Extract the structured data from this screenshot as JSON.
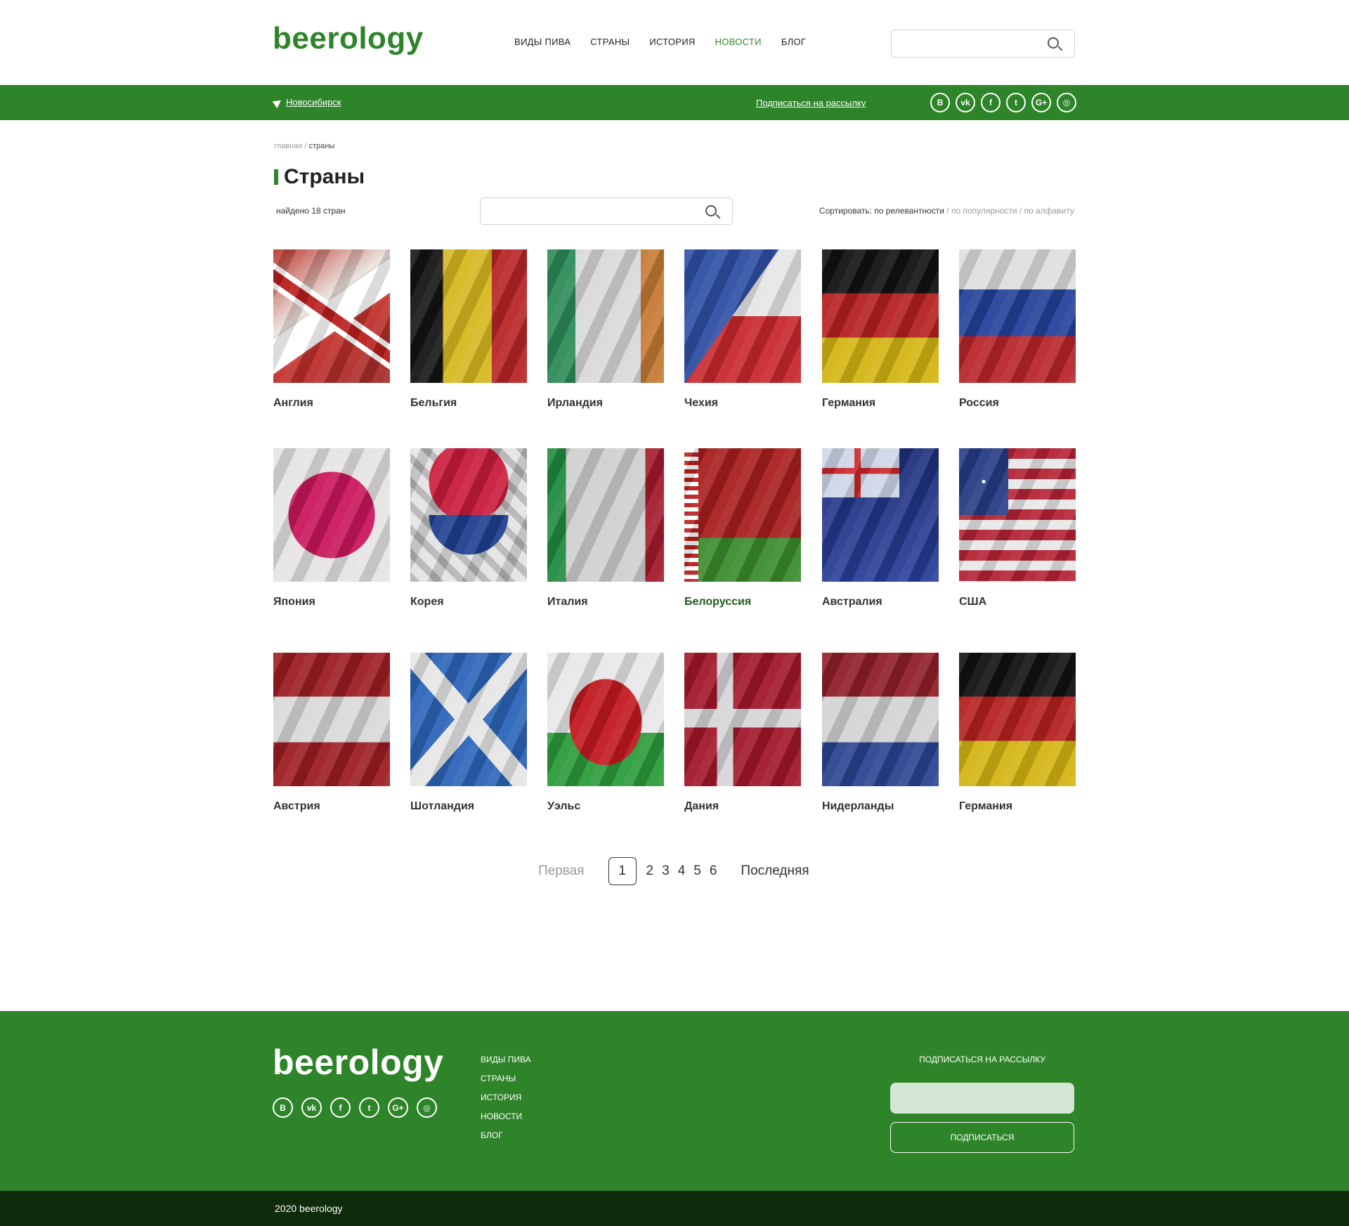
{
  "header": {
    "logo": "beerology",
    "nav": [
      "Виды пива",
      "Страны",
      "История",
      "Новости",
      "Блог"
    ],
    "active_nav_index": 3,
    "search_placeholder": ""
  },
  "topbar": {
    "city": "Новосибирск",
    "subscribe": "Подписаться на рассылку",
    "socials": [
      "vkontakte-b-icon",
      "vk-icon",
      "facebook-icon",
      "twitter-icon",
      "google-plus-icon",
      "instagram-icon"
    ],
    "social_glyphs": [
      "B",
      "vk",
      "f",
      "t",
      "G+",
      "◎"
    ]
  },
  "breadcrumb": {
    "home": "главная",
    "sep": " / ",
    "current": "страны"
  },
  "page": {
    "title": "Страны",
    "found": "найдено 18 стран",
    "sort_label": "Сортировать: по релевантности",
    "sort_sep": " / ",
    "sort_popular": "по популярности",
    "sort_alpha": "по алфавиту"
  },
  "countries": [
    "Англия",
    "Бельгия",
    "Ирландия",
    "Чехия",
    "Германия",
    "Россия",
    "Япония",
    "Корея",
    "Италия",
    "Белоруссия",
    "Австралия",
    "США",
    "Австрия",
    "Шотландия",
    "Уэльс",
    "Дания",
    "Нидерланды",
    "Германия"
  ],
  "pagination": {
    "first": "Первая",
    "pages": [
      "1",
      "2",
      "3",
      "4",
      "5",
      "6"
    ],
    "current": "1",
    "last": "Последняя"
  },
  "footer": {
    "logo": "beerology",
    "menu": [
      "Виды пива",
      "Страны",
      "История",
      "Новости",
      "Блог"
    ],
    "subscribe_title": "Подписаться на рассылку",
    "subscribe_button": "Подписаться",
    "copyright": "2020 beerology"
  },
  "colors": {
    "brand_green": "#2e8429",
    "footer_dark": "#0e2b0b"
  }
}
